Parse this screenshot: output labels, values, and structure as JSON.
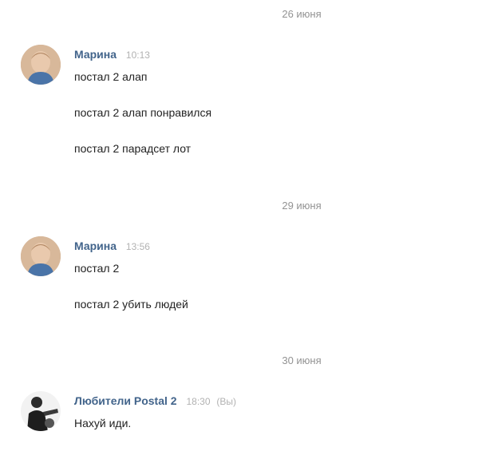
{
  "conversation": {
    "groups": [
      {
        "date": "26 июня",
        "author": "Марина",
        "time": "10:13",
        "messages": [
          "постал 2 алап",
          "постал 2 алап понравился",
          "постал 2 парадсет лот"
        ]
      },
      {
        "date": "29 июня",
        "author": "Марина",
        "time": "13:56",
        "messages": [
          "постал 2",
          "постал 2 убить людей"
        ]
      },
      {
        "date": "30 июня",
        "author": "Любители Postal 2",
        "time": "18:30",
        "you_label": "(Вы)",
        "messages": [
          "Нахуй иди."
        ]
      }
    ]
  },
  "colors": {
    "author": "#42648b",
    "timestamp": "#b2b2b2",
    "date_separator": "#939393",
    "message_text": "#222222"
  },
  "icons": {
    "marina_avatar": "avatar-photo",
    "group_avatar": "group-avatar-photo"
  }
}
